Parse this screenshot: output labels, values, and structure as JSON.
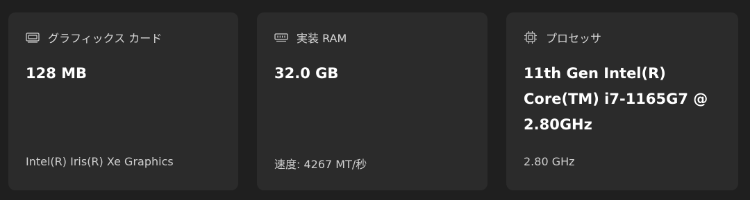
{
  "cards": [
    {
      "icon": "graphics-card-icon",
      "title": "グラフィックス カード",
      "value": "128 MB",
      "subtitle": "Intel(R) Iris(R) Xe Graphics"
    },
    {
      "icon": "memory-icon",
      "title": "実装 RAM",
      "value": "32.0 GB",
      "subtitle": "速度: 4267 MT/秒"
    },
    {
      "icon": "processor-icon",
      "title": "プロセッサ",
      "value": "11th Gen Intel(R) Core(TM) i7-1165G7 @ 2.80GHz",
      "subtitle": "2.80 GHz"
    }
  ]
}
